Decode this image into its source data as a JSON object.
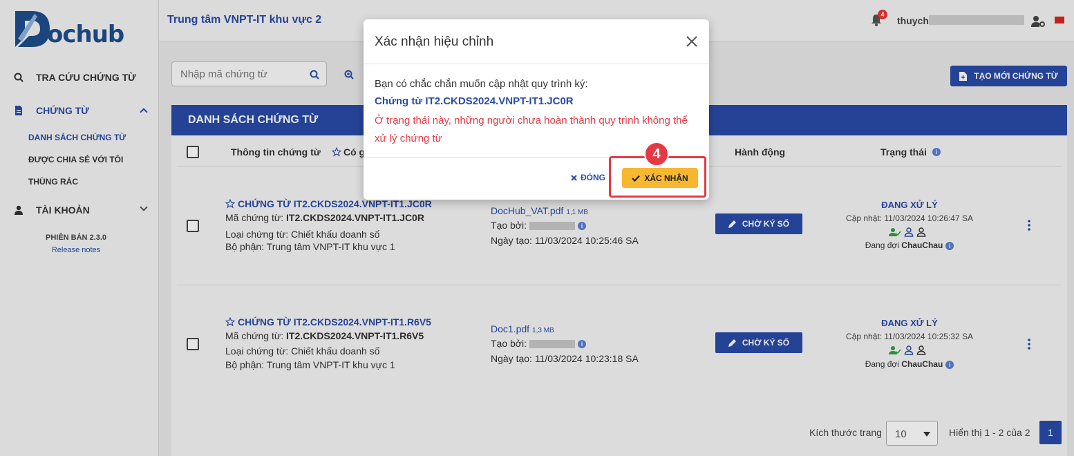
{
  "sidebar": {
    "logo_text": "ochub",
    "nav": {
      "search_docs": "TRA CỨU CHỨNG TỪ",
      "documents": "CHỨNG TỪ",
      "account": "TÀI KHOẢN"
    },
    "sub": {
      "doc_list": "DANH SÁCH CHỨNG TỪ",
      "shared": "ĐƯỢC CHIA SẺ VỚI TÔI",
      "trash": "THÙNG RÁC"
    },
    "version": "PHIÊN BẢN 2.3.0",
    "release_notes": "Release notes"
  },
  "header": {
    "title": "Trung tâm VNPT-IT khu vực 2",
    "notification_count": "4",
    "user_name": "thuych"
  },
  "toolbar": {
    "search_placeholder": "Nhập mã chứng từ",
    "new_doc_label": "TẠO MỚI CHỨNG TỪ"
  },
  "table": {
    "heading": "DANH SÁCH CHỨNG TỪ",
    "columns": {
      "info": "Thông tin chứng từ",
      "fav": "Có g",
      "action": "Hành động",
      "status": "Trạng thái"
    },
    "rows": [
      {
        "title": "CHỨNG TỪ IT2.CKDS2024.VNPT-IT1.JC0R",
        "code_label": "Mã chứng từ:",
        "code": "IT2.CKDS2024.VNPT-IT1.JC0R",
        "type": "Loại chứng từ: Chiết khấu doanh số",
        "dept": "Bộ phận: Trung tâm VNPT-IT khu vực 1",
        "file": "DocHub_VAT.pdf",
        "size": "1,1 MB",
        "created_by": "Tạo bởi:",
        "created_at": "Ngày tạo: 11/03/2024 10:25:46 SA",
        "action": "CHỜ KÝ SỐ",
        "status": "ĐANG XỬ LÝ",
        "updated": "Cập nhật: 11/03/2024 10:26:47 SA",
        "waiting_label": "Đang đợi",
        "waiting_user": "ChauChau"
      },
      {
        "title": "CHỨNG TỪ IT2.CKDS2024.VNPT-IT1.R6V5",
        "code_label": "Mã chứng từ:",
        "code": "IT2.CKDS2024.VNPT-IT1.R6V5",
        "type": "Loại chứng từ: Chiết khấu doanh số",
        "dept": "Bộ phận: Trung tâm VNPT-IT khu vực 1",
        "file": "Doc1.pdf",
        "size": "1,3 MB",
        "created_by": "Tạo bởi:",
        "created_at": "Ngày tạo: 11/03/2024 10:23:18 SA",
        "action": "CHỜ KÝ SỐ",
        "status": "ĐANG XỬ LÝ",
        "updated": "Cập nhật: 11/03/2024 10:25:32 SA",
        "waiting_label": "Đang đợi",
        "waiting_user": "ChauChau"
      }
    ]
  },
  "pagination": {
    "page_size_label": "Kích thước trang",
    "page_size": "10",
    "info": "Hiển thị 1 - 2 của 2",
    "current_page": "1"
  },
  "modal": {
    "title": "Xác nhận hiệu chỉnh",
    "question": "Bạn có chắc chắn muốn cập nhật quy trình ký:",
    "doc": "Chứng từ IT2.CKDS2024.VNPT-IT1.JC0R",
    "warning": "Ở trạng thái này, những người chưa hoàn thành quy trình không thể xử lý chứng từ",
    "close_label": "ĐÓNG",
    "confirm_label": "XÁC NHẬN",
    "step": "4"
  },
  "colors": {
    "primary": "#2a4ba8",
    "confirm": "#f7b731",
    "warning": "#e53945"
  }
}
